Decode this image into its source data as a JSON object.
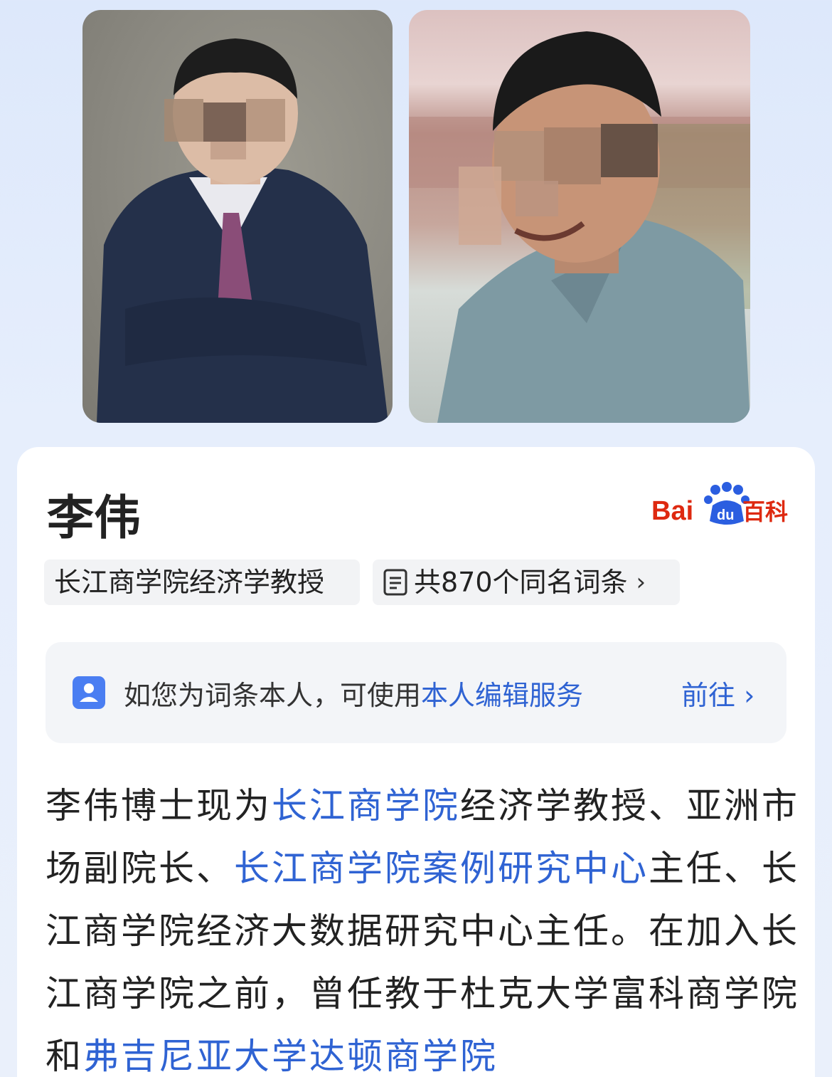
{
  "photos": {
    "left_alt": "",
    "right_alt": ""
  },
  "entry": {
    "title": "李伟",
    "logo": {
      "text_bai": "Bai",
      "text_du": "du",
      "text_baike": "百科"
    },
    "tag_subtitle": "长江商学院经济学教授",
    "tag_homonyms": "共870个同名词条",
    "tag_homonyms_chevron": "›"
  },
  "notice": {
    "prefix": "如您为词条本人，可使用",
    "link": "本人编辑服务",
    "action": "前往 ›"
  },
  "summary": {
    "p1": "李伟博士现为",
    "l1": "长江商学院",
    "p2": "经济学教授、亚洲市场副院长、",
    "l2": "长江商学院案例研究中心",
    "p3": "主任、长江商学院经济大数据研究中心主任。在加入长江商学院之前，曾任教于杜克大学富科商学院和",
    "l3": "弗吉尼亚大学达顿商学院"
  },
  "colors": {
    "link": "#2f63d3",
    "baidu_red": "#de2910",
    "baidu_blue": "#2b5ee0"
  }
}
